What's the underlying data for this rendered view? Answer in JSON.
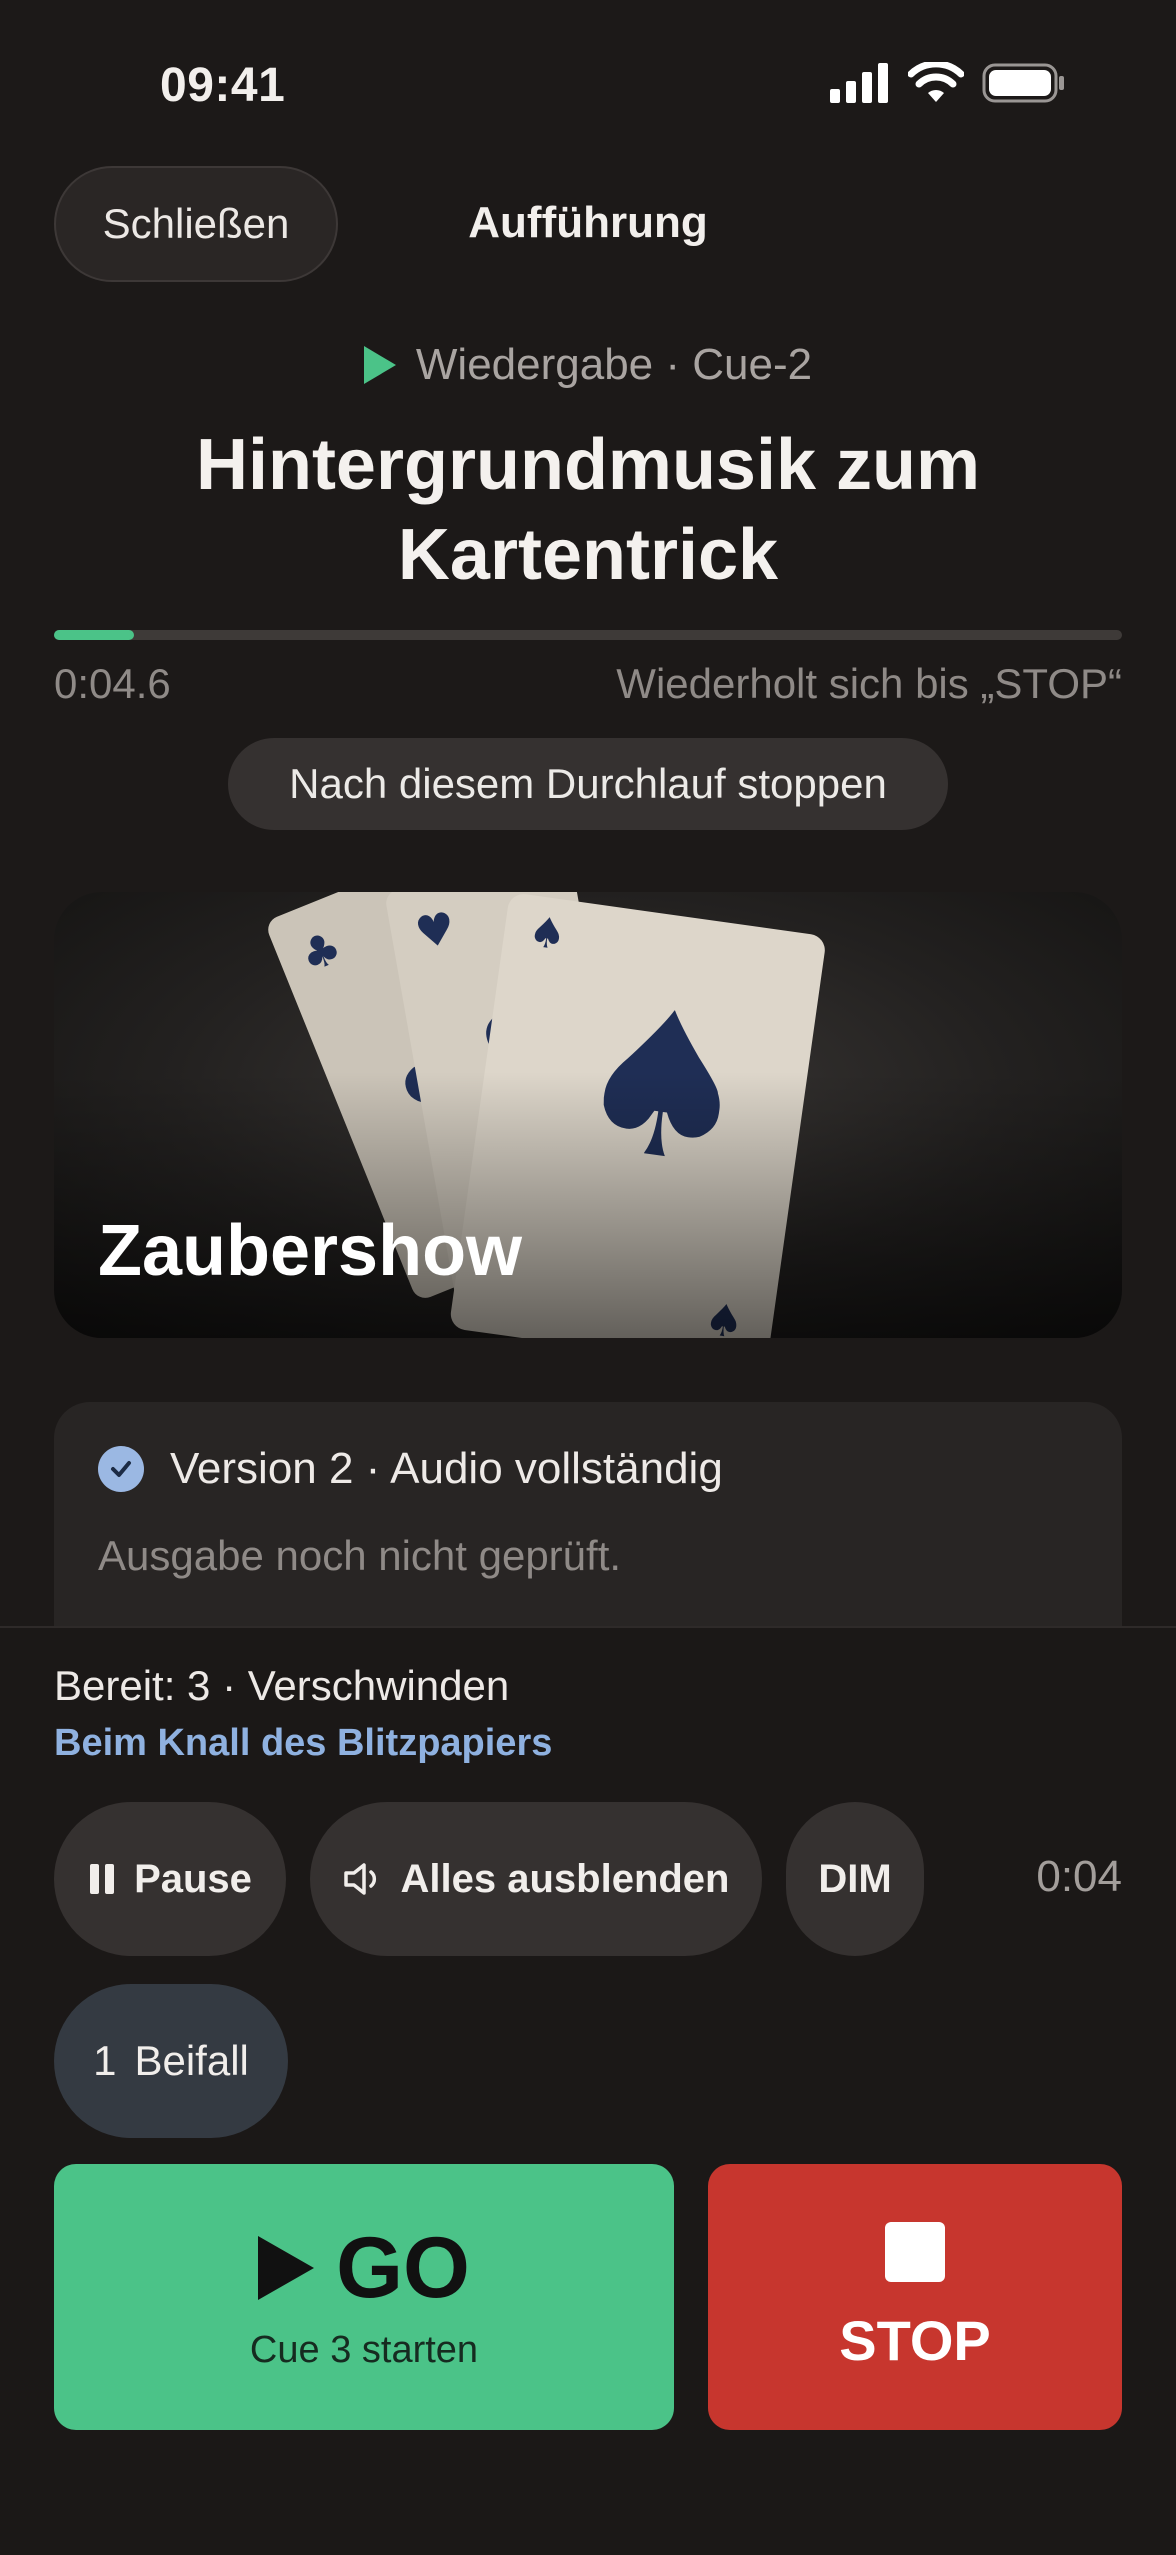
{
  "status_bar": {
    "time": "09:41"
  },
  "header": {
    "close_label": "Schließen",
    "title": "Aufführung"
  },
  "playback": {
    "state_label": "Wiedergabe · Cue-2",
    "cue_title": "Hintergrundmusik zum Kartentrick",
    "progress_fraction": 0.075,
    "elapsed": "0:04.6",
    "loop_info": "Wiederholt sich bis „STOP“",
    "stop_after_label": "Nach diesem Durchlauf stoppen",
    "accent_color": "#4bc388"
  },
  "artwork": {
    "title": "Zaubershow"
  },
  "version_card": {
    "status": "Version 2 · Audio vollständig",
    "note": "Ausgabe noch nicht geprüft."
  },
  "next_cue": {
    "ready_label": "Bereit: 3 · Verschwinden",
    "trigger": "Beim Knall des Blitzpapiers"
  },
  "controls": {
    "pause_label": "Pause",
    "fade_all_label": "Alles ausblenden",
    "dim_label": "DIM",
    "time": "0:04",
    "hotkey_number": "1",
    "hotkey_label": "Beifall"
  },
  "go": {
    "label": "GO",
    "sub": "Cue 3 starten",
    "color": "#4bc388"
  },
  "stop": {
    "label": "STOP",
    "color": "#c7362e"
  }
}
